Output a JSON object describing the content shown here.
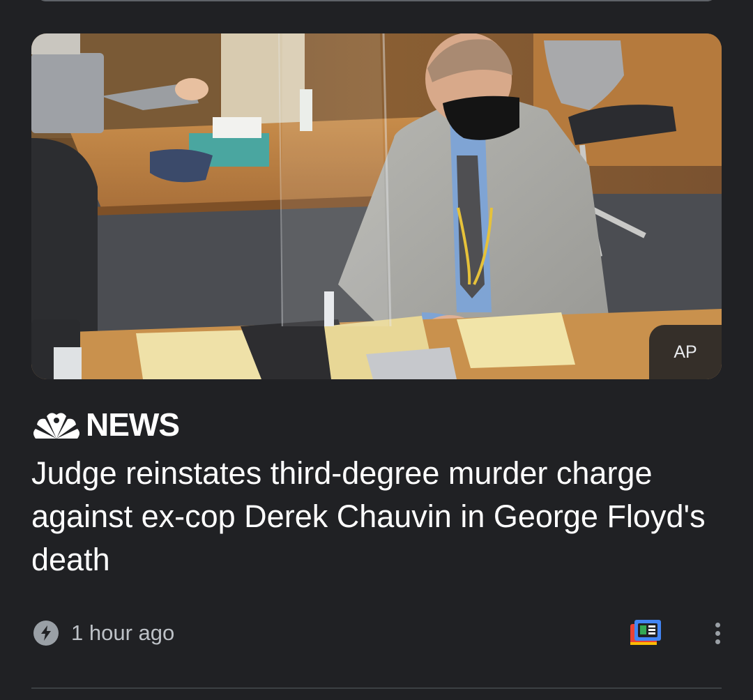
{
  "article": {
    "image_credit": "AP",
    "publisher": "NEWS",
    "headline": "Judge reinstates third-degree murder charge against ex-cop Derek Chauvin in George Floyd's death",
    "timestamp": "1 hour ago"
  },
  "icons": {
    "publisher_logo": "nbc-peacock-icon",
    "timestamp": "bolt-icon",
    "full_coverage": "newsstand-icon",
    "overflow": "more-vert-icon"
  },
  "colors": {
    "background": "#202124",
    "text_primary": "#ffffff",
    "text_secondary": "#bdc1c6",
    "icon_gray": "#9aa0a6"
  }
}
